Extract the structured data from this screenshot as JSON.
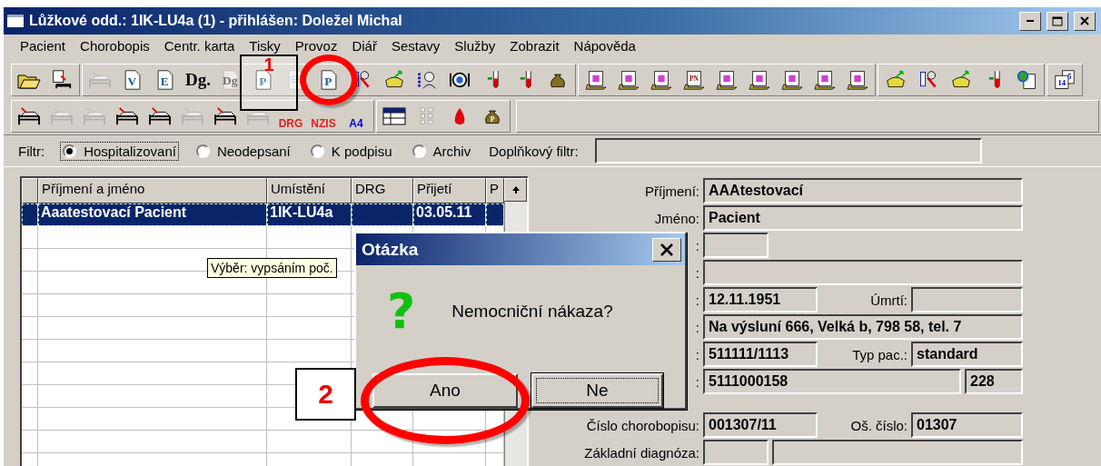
{
  "window": {
    "title": "Lůžkové odd.: 1IK-LU4a (1) - přihlášen: Doležel Michal"
  },
  "menu": [
    {
      "label": "Pacient"
    },
    {
      "label": "Chorobopis"
    },
    {
      "label": "Centr. karta"
    },
    {
      "label": "Tisky"
    },
    {
      "label": "Provoz"
    },
    {
      "label": "Diář"
    },
    {
      "label": "Sestavy"
    },
    {
      "label": "Služby"
    },
    {
      "label": "Zobrazit"
    },
    {
      "label": "Nápověda"
    }
  ],
  "toolbar_1": [
    [
      {
        "kind": "folder",
        "disabled": false
      },
      {
        "kind": "doc-bed",
        "disabled": false
      }
    ],
    [
      {
        "kind": "bed",
        "disabled": true
      },
      {
        "kind": "letter-doc",
        "label": "V",
        "disabled": false
      },
      {
        "kind": "letter-doc",
        "label": "E",
        "disabled": false
      },
      {
        "kind": "text",
        "label": "Dg.",
        "disabled": false
      },
      {
        "kind": "letter-doc",
        "label": "Dg",
        "disabled": true
      },
      {
        "kind": "letter-doc",
        "label": "P",
        "disabled": false
      },
      {
        "kind": "letter-doc",
        "disabled": true
      },
      {
        "kind": "letter-doc",
        "label": "P",
        "disabled": false
      },
      {
        "kind": "tool",
        "disabled": false
      },
      {
        "kind": "phone",
        "disabled": false
      },
      {
        "kind": "person",
        "disabled": false
      },
      {
        "kind": "question",
        "disabled": false
      },
      {
        "kind": "tube",
        "disabled": false
      },
      {
        "kind": "tube",
        "disabled": false
      },
      {
        "kind": "bag",
        "disabled": false
      }
    ],
    [
      {
        "kind": "folder-doc",
        "disabled": false
      },
      {
        "kind": "folder-doc",
        "disabled": false
      },
      {
        "kind": "folder-doc",
        "disabled": false
      },
      {
        "kind": "folder-doc",
        "label": "PN",
        "disabled": false
      },
      {
        "kind": "folder-doc",
        "disabled": false
      },
      {
        "kind": "folder-doc",
        "disabled": false
      },
      {
        "kind": "folder-doc",
        "disabled": false
      },
      {
        "kind": "folder-doc",
        "disabled": false
      },
      {
        "kind": "folder-doc",
        "disabled": false
      }
    ],
    [
      {
        "kind": "phone",
        "disabled": false
      },
      {
        "kind": "tool",
        "disabled": false
      },
      {
        "kind": "phone",
        "disabled": false
      },
      {
        "kind": "tube",
        "disabled": false
      },
      {
        "kind": "globe",
        "disabled": false
      }
    ],
    [
      {
        "kind": "calendar",
        "label": "14",
        "label_2": "5",
        "disabled": false
      }
    ]
  ],
  "toolbar_2": [
    [
      {
        "kind": "bed",
        "disabled": false
      },
      {
        "kind": "bed",
        "disabled": true
      },
      {
        "kind": "bed",
        "disabled": true
      },
      {
        "kind": "bed",
        "disabled": false
      },
      {
        "kind": "bed",
        "disabled": false
      },
      {
        "kind": "bed",
        "disabled": true
      },
      {
        "kind": "bed",
        "disabled": false
      },
      {
        "kind": "bed",
        "disabled": true
      },
      {
        "kind": "badge",
        "label": "DRG",
        "disabled": true
      },
      {
        "kind": "badge",
        "label": "NZIS",
        "disabled": true
      },
      {
        "kind": "badge",
        "label": "A4",
        "disabled": false
      }
    ],
    [
      {
        "kind": "table",
        "disabled": false
      },
      {
        "kind": "grid",
        "disabled": true
      },
      {
        "kind": "drop",
        "disabled": false
      },
      {
        "kind": "bag",
        "label": "P",
        "disabled": false
      }
    ]
  ],
  "filter": {
    "label": "Filtr:",
    "options": [
      {
        "label": "Hospitalizovaní",
        "selected": true
      },
      {
        "label": "Neodepsaní",
        "selected": false
      },
      {
        "label": "K podpisu",
        "selected": false
      },
      {
        "label": "Archiv",
        "selected": false
      }
    ],
    "extra_label": "Doplňkový filtr:"
  },
  "table": {
    "columns": [
      "Příjmení a jméno",
      "Umístění",
      "DRG",
      "Přijetí",
      "P"
    ],
    "rows": [
      {
        "cells": [
          "Aaatestovací Pacient",
          "1IK-LU4a",
          "",
          "03.05.11",
          ""
        ],
        "selected": true
      }
    ]
  },
  "tooltip": "Výběr: vypsáním poč.",
  "form": [
    {
      "label": "Příjmení:",
      "value": "AAAtestovací",
      "kind": "wide"
    },
    {
      "label": "Jméno:",
      "value": "Pacient",
      "kind": "wide"
    },
    {
      "label": ":",
      "kind": "short"
    },
    {
      "label": ":",
      "kind": "wide"
    },
    {
      "label": ":",
      "value": "12.11.1951",
      "label_2": "Úmrtí:",
      "kind": "pair"
    },
    {
      "label": ":",
      "value": "Na výsluní 666, Velká b, 798 58, tel. 7",
      "kind": "wide"
    },
    {
      "label": ":",
      "value": "511111/1113",
      "label_2": "Typ pac.:",
      "value_2": "standard",
      "kind": "pair"
    },
    {
      "label": ":",
      "value": "5111000158",
      "value_2": "228",
      "kind": "split"
    },
    {
      "kind": "gap"
    },
    {
      "label": "Číslo chorobopisu:",
      "value": "001307/11",
      "label_2": "Oš. číslo:",
      "value_2": "01307",
      "kind": "pair"
    },
    {
      "label": "Základní diagnóza:",
      "kind": "diag"
    }
  ],
  "dialog": {
    "title": "Otázka",
    "icon": "?",
    "message": "Nemocniční nákaza?",
    "buttons": [
      {
        "label": "Ano",
        "selected": false
      },
      {
        "label": "Ne",
        "selected": true
      }
    ]
  },
  "callouts": [
    {
      "label": "1"
    },
    {
      "label": "2"
    }
  ]
}
